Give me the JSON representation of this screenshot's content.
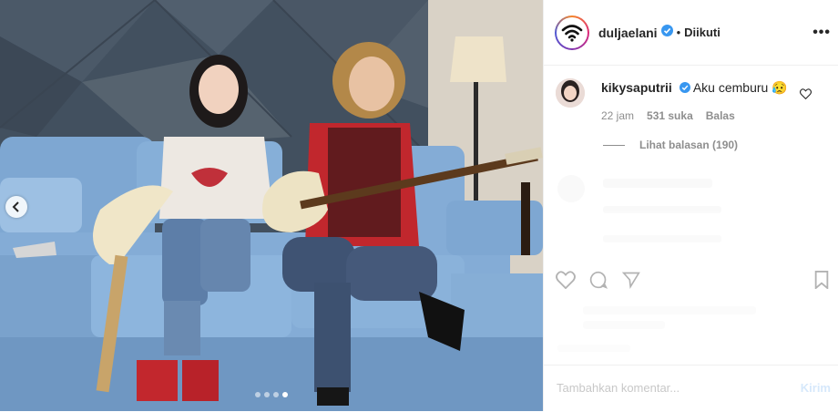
{
  "post": {
    "username": "duljaelani",
    "separator": "•",
    "follow_status": "Diikuti",
    "more_label": "•••"
  },
  "comment": {
    "username": "kikysaputrii",
    "text": "Aku cemburu 😥",
    "time": "22 jam",
    "likes": "531 suka",
    "reply_label": "Balas",
    "view_replies": "Lihat balasan (190)"
  },
  "composer": {
    "placeholder": "Tambahkan komentar...",
    "post_label": "Kirim"
  },
  "carousel": {
    "slide_count": 4,
    "active_index": 3
  },
  "colors": {
    "verified": "#3897f0",
    "text": "#262626",
    "muted": "#8e8e8e"
  }
}
